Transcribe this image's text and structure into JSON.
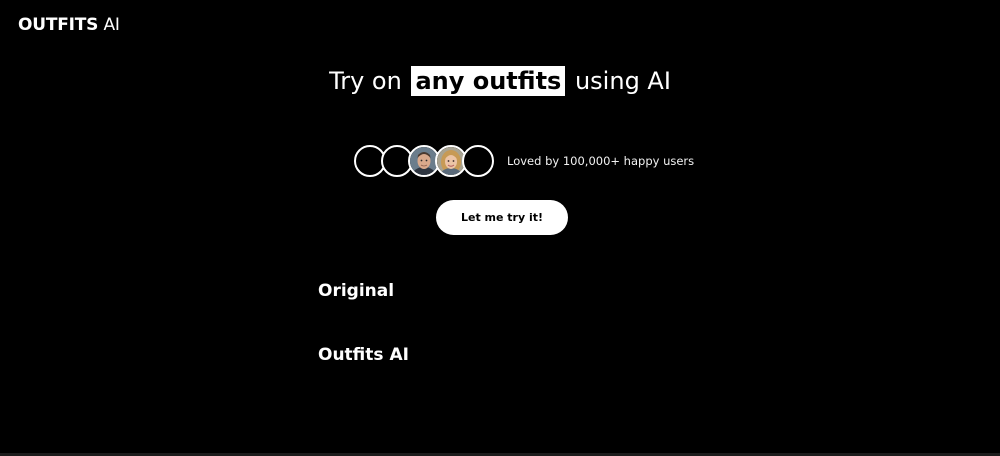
{
  "header": {
    "brand": "OUTFITS",
    "brand_suffix": "AI"
  },
  "hero": {
    "headline_before": "Try on",
    "headline_highlight": "any outfits",
    "headline_after": "using AI",
    "social_proof": "Loved by 100,000+ happy users",
    "cta_label": "Let me try it!"
  },
  "sections": {
    "original_label": "Original",
    "outfits_ai_label": "Outfits AI"
  },
  "colors": {
    "background": "#000000",
    "text": "#ffffff",
    "button_bg": "#ffffff",
    "button_text": "#000000"
  }
}
